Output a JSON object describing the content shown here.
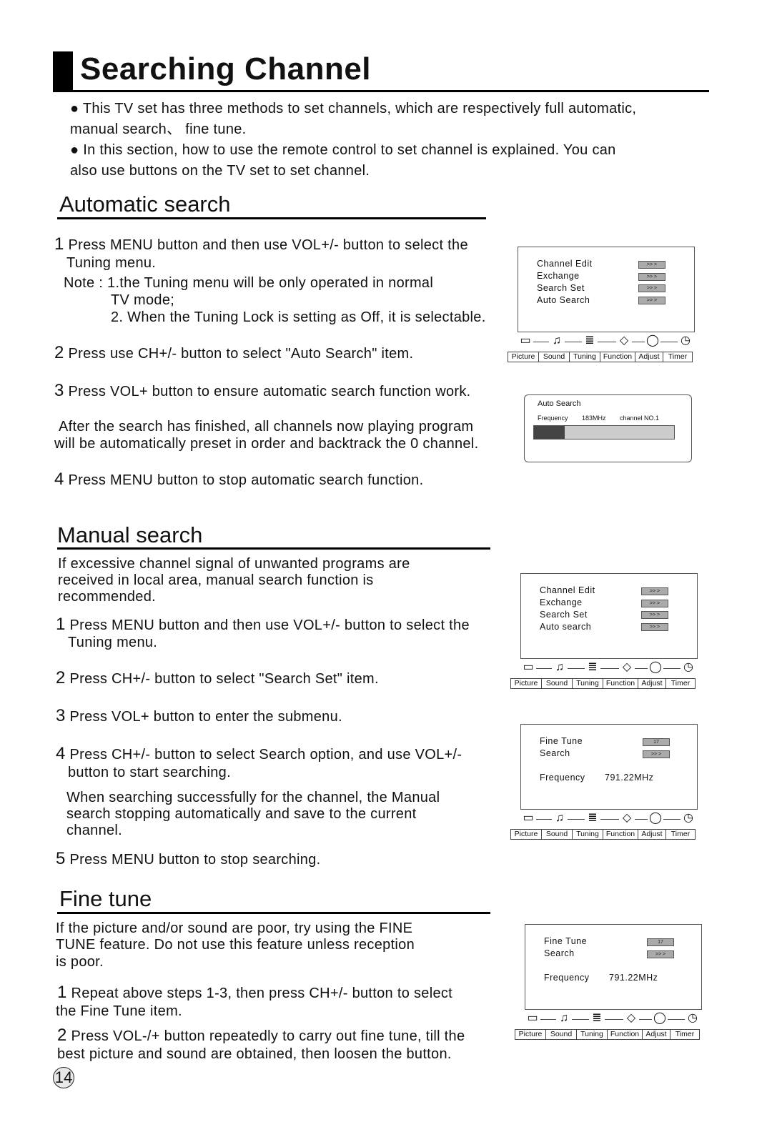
{
  "page": {
    "title": "Searching Channel",
    "page_number": "14",
    "intro": [
      "● This TV set has three methods to set channels, which are respectively full automatic,",
      "manual search、 fine tune.",
      "● In this section, how to use the remote control  to set channel is explained. You can",
      "also use buttons on the TV set to set channel."
    ]
  },
  "auto_search": {
    "heading": "Automatic search",
    "steps": [
      {
        "num": "1",
        "text": "Press MENU button and then use VOL+/- button to select the",
        "text2": "Tuning menu."
      },
      {
        "num": "2",
        "text": "Press use CH+/- button to select  \"Auto Search\" item."
      },
      {
        "num": "3",
        "text": "Press VOL+ button to ensure automatic search function work."
      },
      {
        "num": "4",
        "text": "Press MENU button to stop automatic search function."
      }
    ],
    "note_line1": "Note   : 1.the Tuning  menu will be only operated  in normal",
    "note_line2": "TV mode;",
    "note_line3": "2. When the Tuning Lock is setting as Off, it is selectable.",
    "after_text1": "After the search has finished, all channels now playing program",
    "after_text2": "will be automatically preset in order and backtrack the 0 channel."
  },
  "manual_search": {
    "heading": "Manual search",
    "intro": [
      "If excessive channel signal of    unwanted programs are",
      "received in local area,  manual    search function is",
      "recommended."
    ],
    "steps": [
      {
        "num": "1",
        "text": "Press MENU button and then use VOL+/- button to select the",
        "text2": "Tuning menu."
      },
      {
        "num": "2",
        "text": "Press CH+/- button to select \"Search Set\" item."
      },
      {
        "num": "3",
        "text": "Press VOL+ button to enter the submenu."
      },
      {
        "num": "4",
        "text": "Press CH+/- button to select Search option, and use VOL+/-",
        "text2": "button to start searching."
      },
      {
        "num": "5",
        "text": "Press MENU button to stop searching."
      }
    ],
    "note": [
      "When searching successfully for the channel, the Manual",
      "search stopping automatically and save to the current",
      "channel."
    ]
  },
  "fine_tune": {
    "heading": "Fine tune",
    "intro": [
      "If the picture  and/or sound are  poor, try  using the  FINE",
      "TUNE  feature. Do  not use this  feature unless reception",
      "is poor."
    ],
    "steps": [
      {
        "num": "1",
        "text": "Repeat above steps 1-3,  then press CH+/- button to select",
        "text2": "the Fine Tune item."
      },
      {
        "num": "2",
        "text": "Press VOL-/+ button repeatedly to carry out fine tune, till the",
        "text2": "best picture and sound are obtained, then loosen the button."
      }
    ]
  },
  "osd": {
    "tabs": [
      "Picture",
      "Sound",
      "Tuning",
      "Function",
      "Adjust",
      "Timer"
    ],
    "arrow_label": ">> >",
    "tuning_menu_1": [
      "Channel Edit",
      "Exchange",
      "Search Set",
      "Auto Search"
    ],
    "tuning_menu_2": [
      "Channel Edit",
      "Exchange",
      "Search Set",
      "Auto search"
    ],
    "auto_search_dialog": {
      "title": "Auto Search",
      "frequency_label": "Frequency",
      "frequency_value": "183MHz",
      "channel": "channel NO.1",
      "progress_percent": 22
    },
    "search_set": {
      "fine_tune_label": "Fine Tune",
      "fine_tune_value": "17",
      "search_label": "Search",
      "frequency_label": "Frequency",
      "frequency_value": "791.22MHz"
    }
  }
}
